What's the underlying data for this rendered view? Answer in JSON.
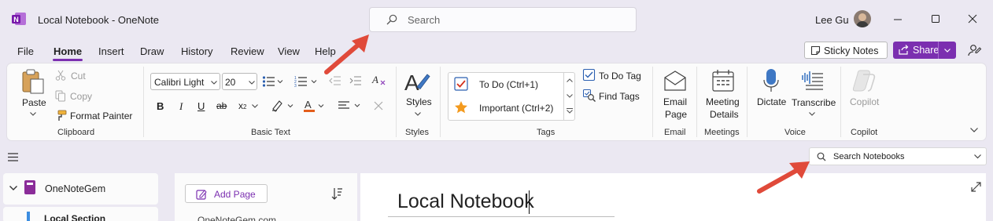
{
  "window": {
    "title": "Local Notebook  -  OneNote",
    "user_name": "Lee Gu"
  },
  "search": {
    "placeholder": "Search"
  },
  "menu": {
    "tabs": [
      "File",
      "Home",
      "Insert",
      "Draw",
      "History",
      "Review",
      "View",
      "Help"
    ],
    "active_tab": "Home"
  },
  "right_actions": {
    "sticky_notes": "Sticky Notes",
    "share": "Share"
  },
  "clipboard": {
    "paste": "Paste",
    "cut": "Cut",
    "copy": "Copy",
    "format_painter": "Format Painter",
    "label": "Clipboard"
  },
  "basic_text": {
    "font": "Calibri Light",
    "size": "20",
    "label": "Basic Text"
  },
  "styles": {
    "button": "Styles",
    "label": "Styles"
  },
  "tags": {
    "todo": "To Do (Ctrl+1)",
    "important": "Important (Ctrl+2)",
    "todo_tag": "To Do Tag",
    "find_tags": "Find Tags",
    "label": "Tags"
  },
  "email": {
    "line1": "Email",
    "line2": "Page",
    "label": "Email"
  },
  "meetings": {
    "line1": "Meeting",
    "line2": "Details",
    "label": "Meetings"
  },
  "voice": {
    "dictate": "Dictate",
    "transcribe": "Transcribe",
    "label": "Voice"
  },
  "copilot": {
    "button": "Copilot",
    "label": "Copilot"
  },
  "notebook_search": {
    "placeholder": "Search Notebooks"
  },
  "navigation": {
    "notebook": "OneNoteGem",
    "section": "Local Section"
  },
  "pages": {
    "add_page": "Add Page",
    "first_page": "OneNoteGem.com"
  },
  "page": {
    "title": "Local Notebook"
  },
  "colors": {
    "accent": "#7b2fb0",
    "onenote_purple": "#7719aa",
    "arrow_red": "#e04a3a"
  }
}
